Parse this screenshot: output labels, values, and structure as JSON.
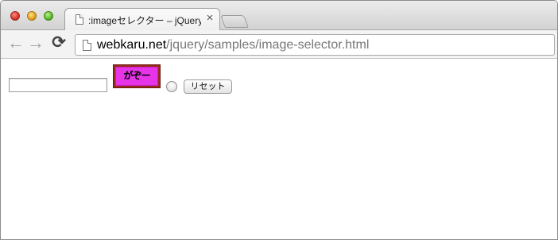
{
  "browser": {
    "tab_title": ":imageセレクター – jQuery入",
    "tab_close": "×",
    "url_host": "webkaru.net",
    "url_path": "/jquery/samples/image-selector.html"
  },
  "nav": {
    "back": "←",
    "forward": "→",
    "reload": "⟳"
  },
  "page": {
    "text_input_value": "",
    "image_button_label": "がぞー",
    "image_button_bg": "#e834e8",
    "image_button_border": "#9a2a1a",
    "reset_label": "リセット"
  }
}
